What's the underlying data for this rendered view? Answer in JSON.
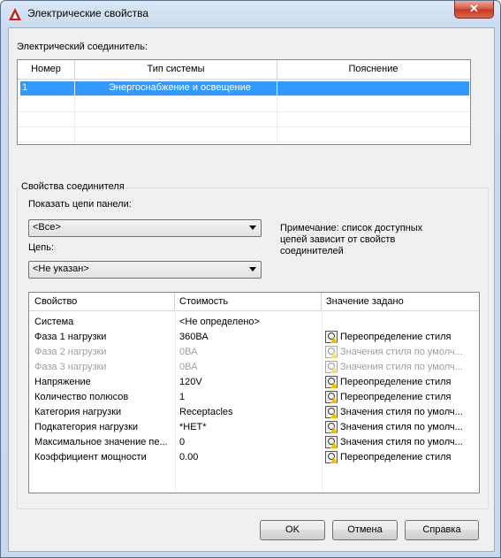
{
  "window": {
    "title": "Электрические свойства",
    "close_label": "✕"
  },
  "connector_section": {
    "label": "Электрический соединитель:",
    "columns": [
      "Номер",
      "Тип системы",
      "Пояснение"
    ],
    "rows": [
      {
        "number": "1",
        "system_type": "Энергоснабжение и освещение",
        "note": ""
      }
    ]
  },
  "connector_props": {
    "group_title": "Свойства соединителя",
    "panel_label": "Показать цепи панели:",
    "panel_value": "<Все>",
    "circuit_label": "Цепь:",
    "circuit_value": "<Не указан>",
    "note": [
      "Примечание: список доступных",
      "цепей зависит от свойств",
      "соединителей"
    ]
  },
  "props_grid": {
    "columns": [
      "Свойство",
      "Стоимость",
      "Значение задано"
    ],
    "rows": [
      {
        "name": "Система",
        "value": "<Не определено>",
        "source": "",
        "disabled": false,
        "icon": false
      },
      {
        "name": "Фаза 1 нагрузки",
        "value": "360ВА",
        "source": "Переопределение стиля",
        "disabled": false,
        "icon": true
      },
      {
        "name": "Фаза 2 нагрузки",
        "value": "0ВА",
        "source": "Значения стиля по умолч...",
        "disabled": true,
        "icon": true
      },
      {
        "name": "Фаза 3 нагрузки",
        "value": "0ВА",
        "source": "Значения стиля по умолч...",
        "disabled": true,
        "icon": true
      },
      {
        "name": "Напряжение",
        "value": "120V",
        "source": "Переопределение стиля",
        "disabled": false,
        "icon": true
      },
      {
        "name": "Количество полюсов",
        "value": "1",
        "source": "Переопределение стиля",
        "disabled": false,
        "icon": true
      },
      {
        "name": "Категория нагрузки",
        "value": "Receptacles",
        "source": "Значения стиля по умолч...",
        "disabled": false,
        "icon": true
      },
      {
        "name": "Подкатегория нагрузки",
        "value": "*НЕТ*",
        "source": "Значения стиля по умолч...",
        "disabled": false,
        "icon": true
      },
      {
        "name": "Максимальное значение пе...",
        "value": "0",
        "source": "Значения стиля по умолч...",
        "disabled": false,
        "icon": true
      },
      {
        "name": "Коэффициент мощности",
        "value": "0.00",
        "source": "Переопределение стиля",
        "disabled": false,
        "icon": true
      }
    ]
  },
  "buttons": {
    "ok": "OK",
    "cancel": "Отмена",
    "help": "Справка"
  },
  "colors": {
    "selection": "#3399ff",
    "title_bg": "#c7d9ed",
    "close": "#c8361f"
  }
}
